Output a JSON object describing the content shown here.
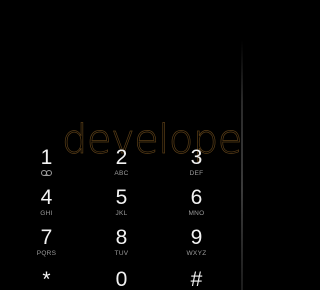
{
  "watermark": "developers",
  "keypad": [
    [
      {
        "digit": "1",
        "letters": "",
        "icon": "voicemail-icon"
      },
      {
        "digit": "2",
        "letters": "ABC"
      },
      {
        "digit": "3",
        "letters": "DEF"
      }
    ],
    [
      {
        "digit": "4",
        "letters": "GHI"
      },
      {
        "digit": "5",
        "letters": "JKL"
      },
      {
        "digit": "6",
        "letters": "MNO"
      }
    ],
    [
      {
        "digit": "7",
        "letters": "PQRS"
      },
      {
        "digit": "8",
        "letters": "TUV"
      },
      {
        "digit": "9",
        "letters": "WXYZ"
      }
    ],
    [
      {
        "digit": "*",
        "letters": ""
      },
      {
        "digit": "0",
        "letters": ""
      },
      {
        "digit": "#",
        "letters": ""
      }
    ]
  ]
}
